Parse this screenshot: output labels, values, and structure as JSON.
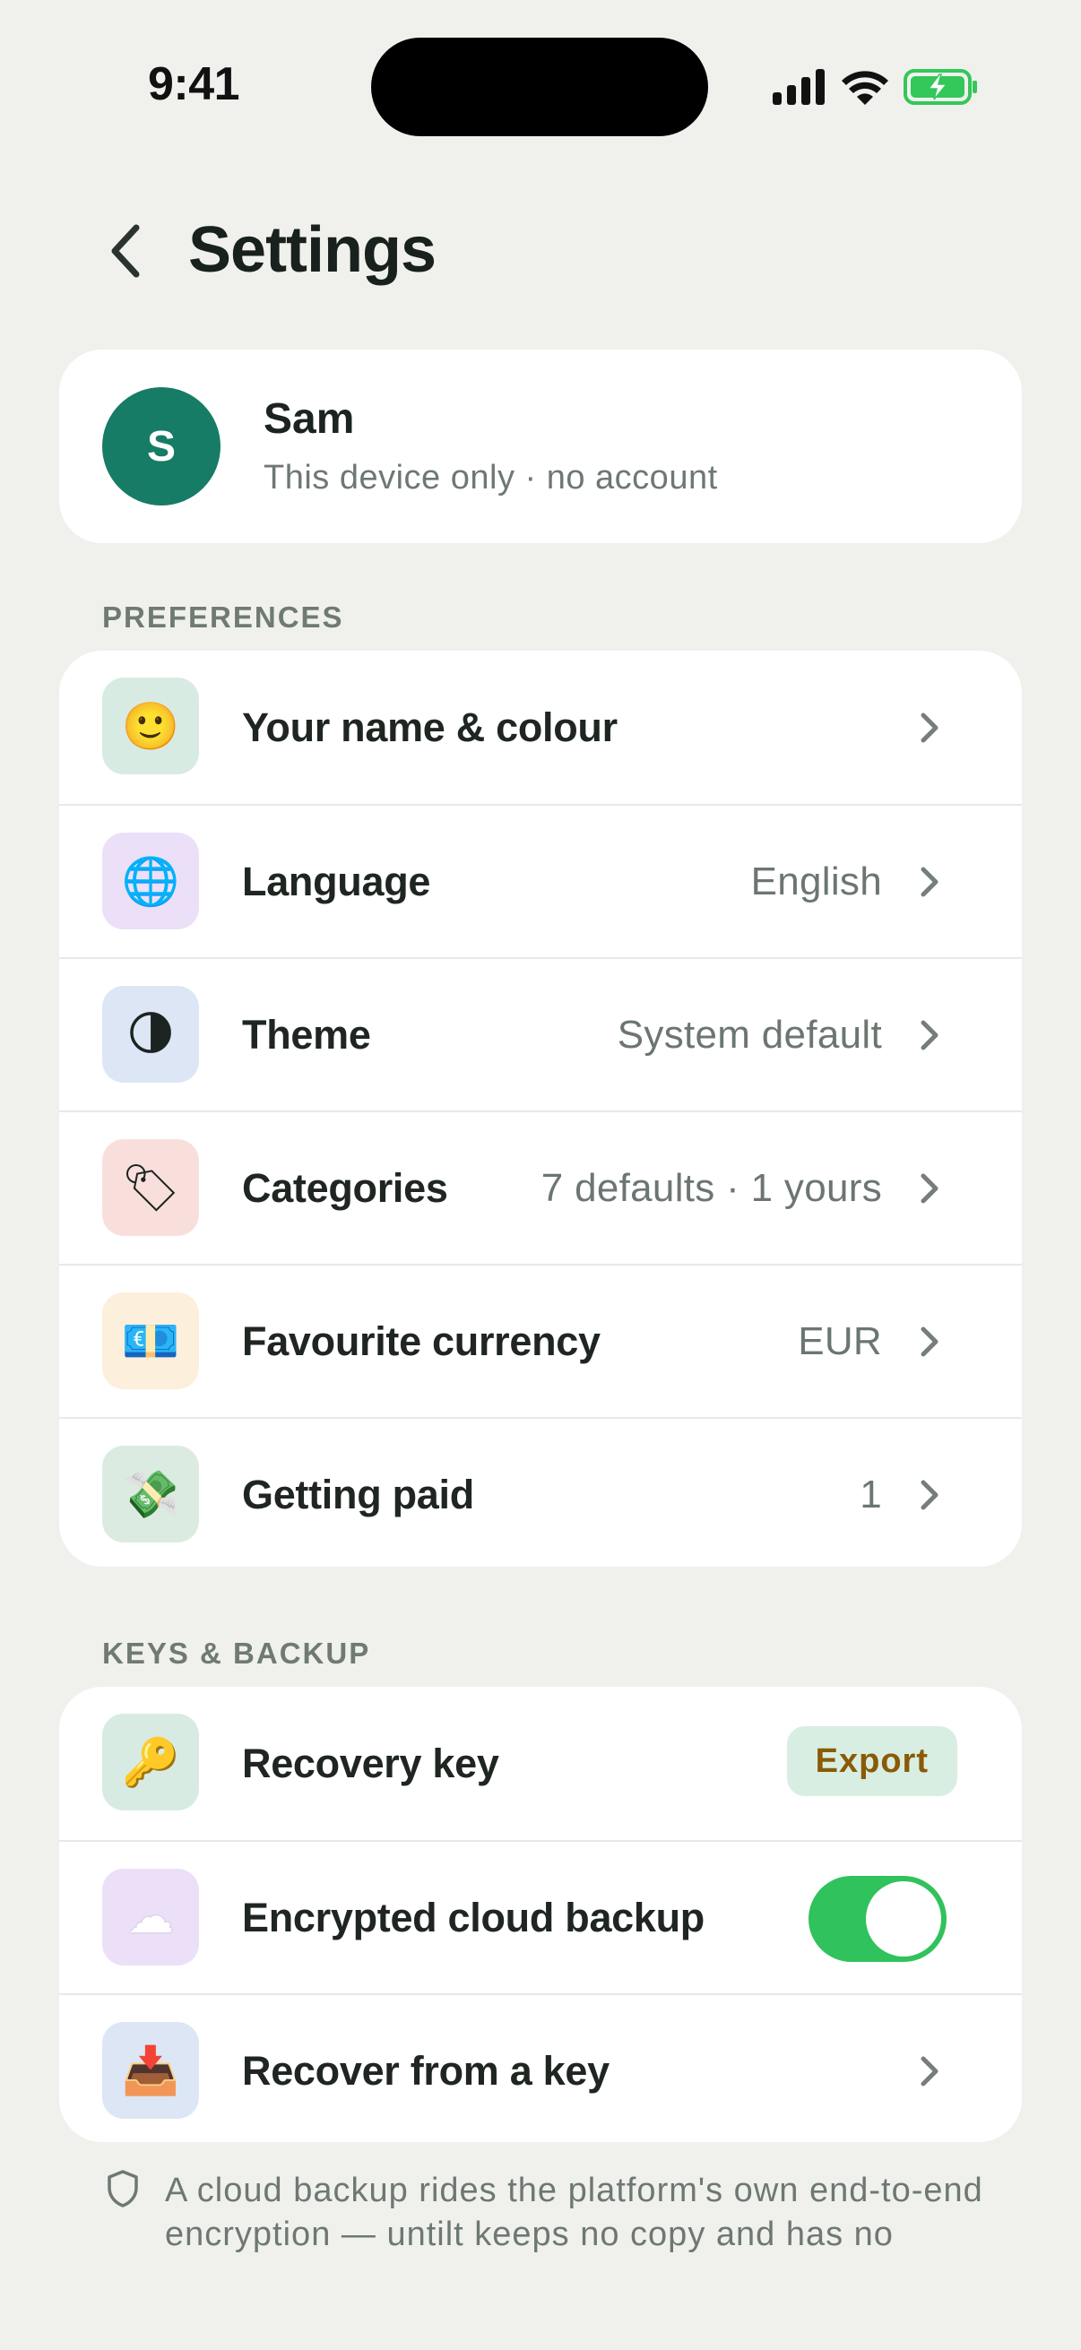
{
  "status_bar": {
    "time": "9:41",
    "icons": [
      "signal-icon",
      "wifi-icon",
      "battery-charging-icon"
    ],
    "battery_color": "#34c759"
  },
  "header": {
    "back_icon": "chevron-left-icon",
    "title": "Settings"
  },
  "profile": {
    "initial": "S",
    "name": "Sam",
    "subtitle": "This device only · no account",
    "avatar_color": "#167c66"
  },
  "preferences": {
    "label": "PREFERENCES",
    "items": [
      {
        "icon": "🙂",
        "icon_name": "smiley-icon",
        "tile_color": "#d8ebe3",
        "label": "Your name & colour",
        "value": ""
      },
      {
        "icon": "🌐",
        "icon_name": "globe-icon",
        "tile_color": "#ebe0f7",
        "label": "Language",
        "value": "English"
      },
      {
        "icon": "🌗",
        "icon_name": "moon-icon",
        "tile_color": "#dce6f5",
        "label": "Theme",
        "value": "System default"
      },
      {
        "icon": "🏷",
        "icon_name": "tag-icon",
        "tile_color": "#f9dfdc",
        "label": "Categories",
        "value": "7 defaults · 1 yours"
      },
      {
        "icon": "💶",
        "icon_name": "banknote-icon",
        "tile_color": "#fcefdb",
        "label": "Favourite currency",
        "value": "EUR"
      },
      {
        "icon": "💸",
        "icon_name": "money-wings-icon",
        "tile_color": "#dbebe2",
        "label": "Getting paid",
        "value": "1"
      }
    ]
  },
  "keys_backup": {
    "label": "KEYS & BACKUP",
    "recovery": {
      "icon": "🔑",
      "icon_name": "key-icon",
      "tile_color": "#d8ebe3",
      "label": "Recovery key",
      "action": "Export"
    },
    "cloud": {
      "icon": "☁",
      "icon_name": "cloud-icon",
      "tile_color": "#ebe0f7",
      "label": "Encrypted cloud backup",
      "enabled": true
    },
    "recover": {
      "icon": "📥",
      "icon_name": "inbox-tray-icon",
      "tile_color": "#dce6f5",
      "label": "Recover from a key"
    }
  },
  "footnote": {
    "icon": "shield-icon",
    "text": "A cloud backup rides the platform's own end-to-end encryption — untilt keeps no copy and has no"
  }
}
